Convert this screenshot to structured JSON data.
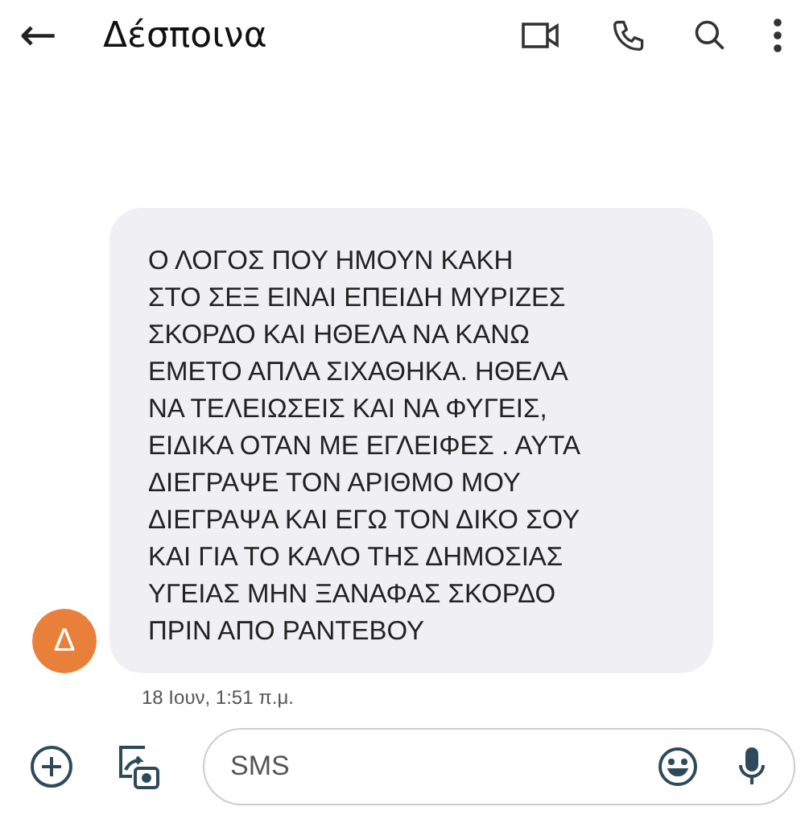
{
  "header": {
    "back": "←",
    "title": "Δέσποινα"
  },
  "message": {
    "avatar": "Δ",
    "lines": [
      "Ο ΛΟΓΟΣ ΠΟΥ ΗΜΟΥΝ ΚΑΚΗ",
      "ΣΤΟ ΣΕΞ ΕΙΝΑΙ ΕΠΕΙΔΗ ΜΥΡΙΖΕΣ",
      "ΣΚΟΡΔΟ ΚΑΙ ΗΘΕΛΑ ΝΑ ΚΑΝΩ",
      "ΕΜΕΤΟ ΑΠΛΑ ΣΙΧΑΘΗΚΑ. ΗΘΕΛΑ",
      "ΝΑ ΤΕΛΕΙΩΣΕΙΣ ΚΑΙ ΝΑ ΦΥΓΕΙΣ,",
      "ΕΙΔΙΚΑ ΟΤΑΝ ΜΕ ΕΓΛΕΙΦΕΣ . ΑΥΤΑ",
      "ΔΙΕΓΡΑΨΕ ΤΟΝ ΑΡΙΘΜΟ ΜΟΥ",
      "ΔΙΕΓΡΑΨΑ ΚΑΙ ΕΓΩ ΤΟΝ ΔΙΚΟ ΣΟΥ",
      "ΚΑΙ ΓΙΑ ΤΟ ΚΑΛΟ ΤΗΣ ΔΗΜΟΣΙΑΣ",
      "ΥΓΕΙΑΣ ΜΗΝ ΞΑΝΑΦΑΣ ΣΚΟΡΔΟ",
      "ΠΡΙΝ ΑΠΟ ΡΑΝΤΕΒΟΥ"
    ],
    "time": "18 Ιουν, 1:51 π.μ."
  },
  "composer": {
    "placeholder": "SMS"
  }
}
